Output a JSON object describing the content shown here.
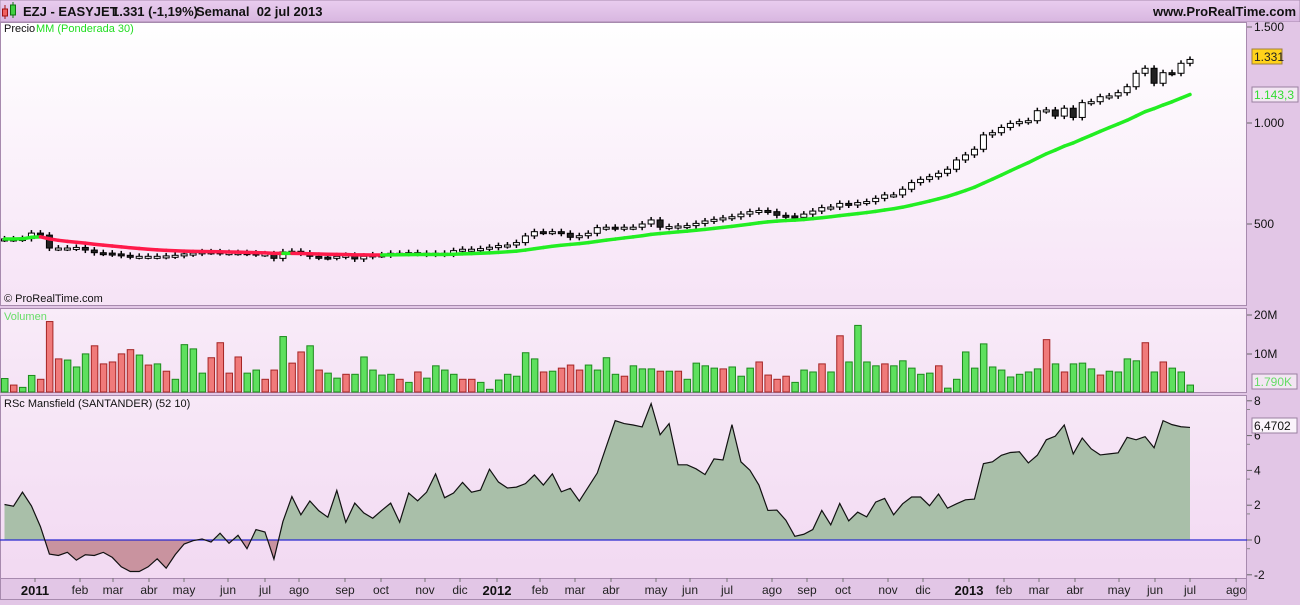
{
  "header": {
    "symbol": "EZJ - EASYJET",
    "price_change": "1.331 (-1,19%)",
    "period": "Semanal  02 jul 2013",
    "site": "www.ProRealTime.com",
    "logo_icon": "candlestick-icon"
  },
  "price_panel": {
    "label_price": "Precio",
    "label_ma": "MM (Ponderada 30)",
    "copyright": "© ProRealTime.com",
    "axis_ticks": [
      "1.500",
      "1.000",
      "500"
    ],
    "last_price_label": "1.331",
    "last_ma_label": "1.143,3",
    "colors": {
      "ma_up": "#22ee22",
      "ma_down": "#ff1a4a",
      "last_price_bg": "#ffd21a"
    }
  },
  "volume_panel": {
    "label": "Volumen",
    "axis_ticks": [
      "20M",
      "10M"
    ],
    "last_label": "1.790K",
    "colors": {
      "up": "#5ee05e",
      "down": "#f07a7a"
    }
  },
  "rsc_panel": {
    "label": "RSc Mansfield (SANTANDER) (52 10)",
    "axis_ticks": [
      "8",
      "6",
      "4",
      "2",
      "0",
      "-2"
    ],
    "last_label": "6,4702",
    "colors": {
      "positive": "#a9bfa9",
      "negative": "#c9939f",
      "zero_line": "#2a2ad0"
    }
  },
  "date_axis": [
    "2011",
    "feb",
    "mar",
    "abr",
    "may",
    "jun",
    "jul",
    "ago",
    "sep",
    "oct",
    "nov",
    "dic",
    "2012",
    "feb",
    "mar",
    "abr",
    "may",
    "jun",
    "jul",
    "ago",
    "sep",
    "oct",
    "nov",
    "dic",
    "2013",
    "feb",
    "mar",
    "abr",
    "may",
    "jun",
    "jul",
    "ago"
  ],
  "chart_data": {
    "type": "candlestick",
    "frequency": "weekly",
    "price_axis_ticks": [
      500,
      1000,
      1500
    ],
    "close": [
      426,
      426,
      428,
      455,
      445,
      381,
      381,
      381,
      384,
      371,
      358,
      356,
      352,
      345,
      340,
      340,
      340,
      340,
      342,
      345,
      352,
      356,
      362,
      362,
      358,
      358,
      358,
      356,
      352,
      352,
      330,
      362,
      365,
      356,
      340,
      336,
      335,
      340,
      345,
      327,
      340,
      347,
      347,
      355,
      355,
      358,
      355,
      351,
      355,
      351,
      368,
      375,
      375,
      378,
      385,
      393,
      396,
      408,
      441,
      462,
      460,
      462,
      454,
      434,
      442,
      454,
      482,
      484,
      479,
      484,
      484,
      500,
      520,
      484,
      487,
      490,
      492,
      503,
      515,
      523,
      530,
      536,
      549,
      561,
      567,
      561,
      543,
      540,
      533,
      549,
      564,
      581,
      584,
      602,
      594,
      606,
      611,
      627,
      644,
      644,
      672,
      705,
      721,
      734,
      751,
      771,
      817,
      842,
      870,
      941,
      952,
      978,
      998,
      1007,
      1012,
      1064,
      1068,
      1036,
      1077,
      1029,
      1106,
      1111,
      1137,
      1141,
      1158,
      1189,
      1259,
      1285,
      1207,
      1262,
      1259,
      1311,
      1331
    ],
    "moving_average": {
      "type": "weighted",
      "period": 30
    },
    "volume_millions": [
      3.5,
      1.8,
      1.2,
      4.3,
      3.3,
      18.3,
      8.6,
      8.3,
      6.5,
      9.9,
      12.0,
      7.3,
      7.8,
      9.9,
      11.0,
      9.6,
      7.0,
      7.3,
      5.4,
      3.3,
      12.3,
      11.2,
      4.9,
      8.9,
      12.8,
      4.9,
      9.1,
      4.9,
      5.7,
      3.3,
      5.7,
      14.4,
      7.5,
      10.4,
      12.0,
      5.7,
      4.9,
      3.6,
      4.6,
      4.6,
      9.1,
      5.7,
      4.4,
      4.6,
      3.3,
      2.5,
      5.2,
      3.6,
      6.8,
      5.7,
      4.6,
      3.3,
      3.3,
      2.5,
      0.7,
      3.1,
      4.6,
      4.1,
      10.2,
      8.6,
      5.2,
      5.4,
      6.2,
      7.0,
      5.7,
      7.0,
      5.7,
      8.9,
      4.6,
      4.1,
      6.8,
      6.0,
      6.0,
      5.4,
      5.4,
      5.4,
      3.3,
      7.5,
      6.8,
      6.2,
      6.0,
      6.5,
      4.1,
      6.2,
      7.8,
      4.4,
      3.3,
      4.1,
      2.5,
      5.7,
      5.2,
      7.3,
      5.2,
      14.6,
      7.8,
      17.3,
      7.8,
      6.8,
      7.3,
      6.8,
      8.1,
      6.2,
      4.6,
      4.9,
      6.8,
      1.0,
      3.3,
      10.4,
      6.2,
      12.5,
      6.5,
      5.7,
      3.9,
      4.6,
      5.2,
      6.0,
      13.6,
      7.3,
      5.2,
      7.3,
      7.5,
      6.0,
      4.4,
      5.4,
      5.2,
      8.6,
      8.1,
      12.8,
      5.2,
      7.8,
      6.2,
      5.2,
      1.8
    ],
    "volume_direction": "UDUUDDDUUUDDDDDUDUDUUUUDDDDUUDDUDDUDUUDUUUUUDUDUUUUDDUUUUUUUDUDDDUUUUDUUUDUDUUUUDUUUDDDDUUUDUDUUUUDUUUUUDUUUUUUUUUUUDUDUUUDUUUUDUDU",
    "volume_axis_ticks": [
      10,
      20
    ],
    "rsc": [
      2.04,
      1.94,
      2.75,
      1.96,
      0.77,
      -0.81,
      -0.89,
      -0.71,
      -1.16,
      -0.85,
      -0.89,
      -0.71,
      -1.0,
      -1.54,
      -1.81,
      -1.81,
      -1.54,
      -1.08,
      -1.62,
      -0.85,
      -0.23,
      -0.04,
      0.06,
      -0.12,
      0.39,
      -0.19,
      0.27,
      -0.5,
      0.6,
      0.46,
      -1.1,
      1.06,
      2.5,
      1.45,
      2.24,
      1.68,
      1.31,
      2.85,
      1.02,
      2.12,
      1.56,
      1.25,
      1.7,
      2.12,
      1.02,
      2.7,
      2.25,
      2.75,
      3.8,
      2.43,
      2.7,
      3.31,
      2.75,
      2.87,
      4.07,
      3.33,
      2.99,
      3.04,
      3.24,
      3.74,
      3.16,
      3.8,
      2.77,
      2.97,
      2.24,
      3.04,
      3.85,
      5.36,
      6.86,
      6.69,
      6.61,
      6.5,
      7.84,
      6.05,
      6.69,
      4.32,
      4.32,
      4.09,
      3.76,
      4.66,
      4.6,
      6.63,
      4.49,
      4.01,
      3.16,
      1.7,
      1.72,
      1.14,
      0.21,
      0.33,
      0.6,
      1.7,
      0.87,
      2.1,
      1.1,
      1.6,
      1.33,
      2.18,
      2.39,
      1.45,
      2.08,
      2.47,
      2.47,
      1.97,
      2.64,
      1.83,
      2.08,
      2.31,
      2.35,
      4.39,
      4.49,
      4.87,
      5.03,
      5.07,
      4.43,
      4.87,
      5.76,
      5.97,
      6.61,
      4.95,
      5.86,
      5.24,
      4.89,
      4.95,
      5.01,
      5.9,
      5.76,
      5.94,
      5.3,
      6.86,
      6.63,
      6.51,
      6.47
    ],
    "rsc_axis_range": [
      -2,
      8
    ]
  }
}
